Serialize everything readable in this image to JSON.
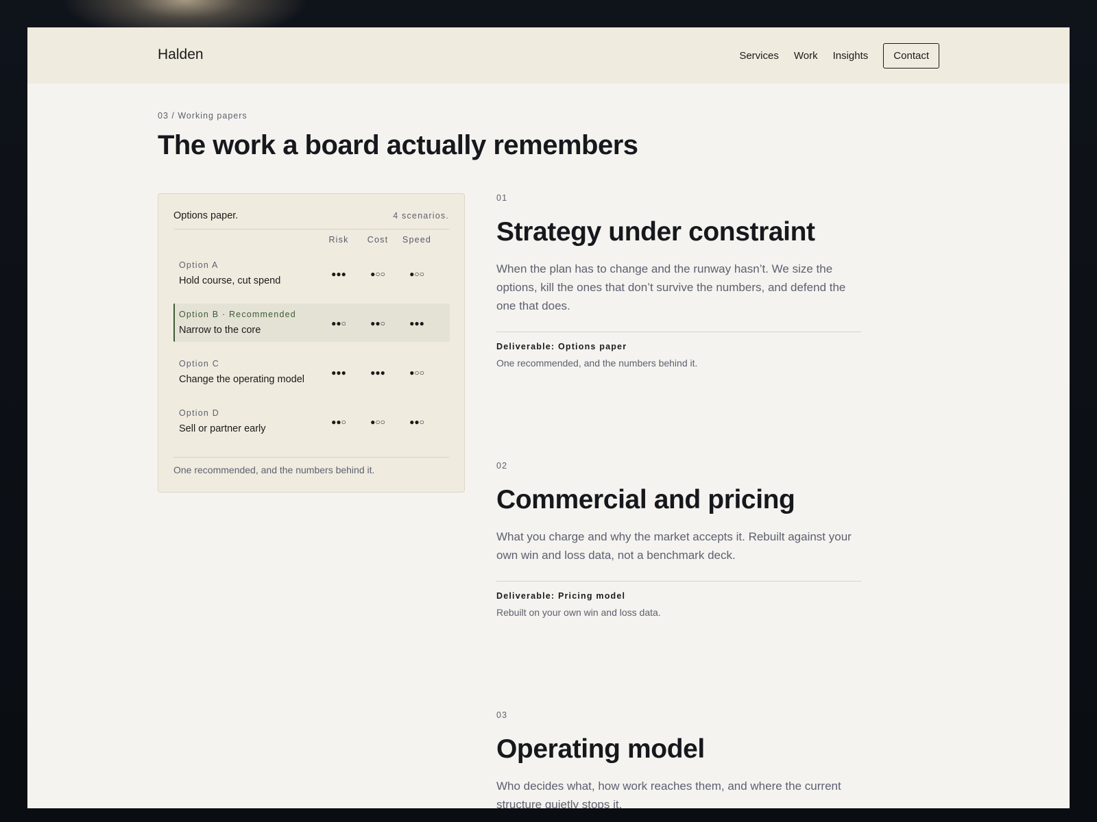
{
  "header": {
    "brand": "Halden",
    "nav": [
      "Services",
      "Work",
      "Insights"
    ],
    "contact_label": "Contact"
  },
  "section": {
    "eyebrow": "03 / Working papers",
    "title": "The work a board actually remembers"
  },
  "card": {
    "title": "Options paper.",
    "count": "4 scenarios.",
    "columns": [
      "Risk",
      "Cost",
      "Speed"
    ],
    "rows": [
      {
        "label": "Option A",
        "desc": "Hold course, cut spend",
        "risk": "●●●",
        "cost": "●○○",
        "speed": "●○○",
        "recommended": false
      },
      {
        "label": "Option B · Recommended",
        "desc": "Narrow to the core",
        "risk": "●●○",
        "cost": "●●○",
        "speed": "●●●",
        "recommended": true
      },
      {
        "label": "Option C",
        "desc": "Change the operating model",
        "risk": "●●●",
        "cost": "●●●",
        "speed": "●○○",
        "recommended": false
      },
      {
        "label": "Option D",
        "desc": "Sell or partner early",
        "risk": "●●○",
        "cost": "●○○",
        "speed": "●●○",
        "recommended": false
      }
    ],
    "footer": "One recommended, and the numbers behind it."
  },
  "services": [
    {
      "num": "01",
      "title": "Strategy under constraint",
      "body": "When the plan has to change and the runway hasn’t. We size the options, kill the ones that don’t survive the numbers, and defend the one that does.",
      "deliverable": "Deliverable: Options paper",
      "deliverable_sub": "One recommended, and the numbers behind it."
    },
    {
      "num": "02",
      "title": "Commercial and pricing",
      "body": "What you charge and why the market accepts it. Rebuilt against your own win and loss data, not a benchmark deck.",
      "deliverable": "Deliverable: Pricing model",
      "deliverable_sub": "Rebuilt on your own win and loss data."
    },
    {
      "num": "03",
      "title": "Operating model",
      "body": "Who decides what, how work reaches them, and where the current structure quietly stops it."
    }
  ]
}
